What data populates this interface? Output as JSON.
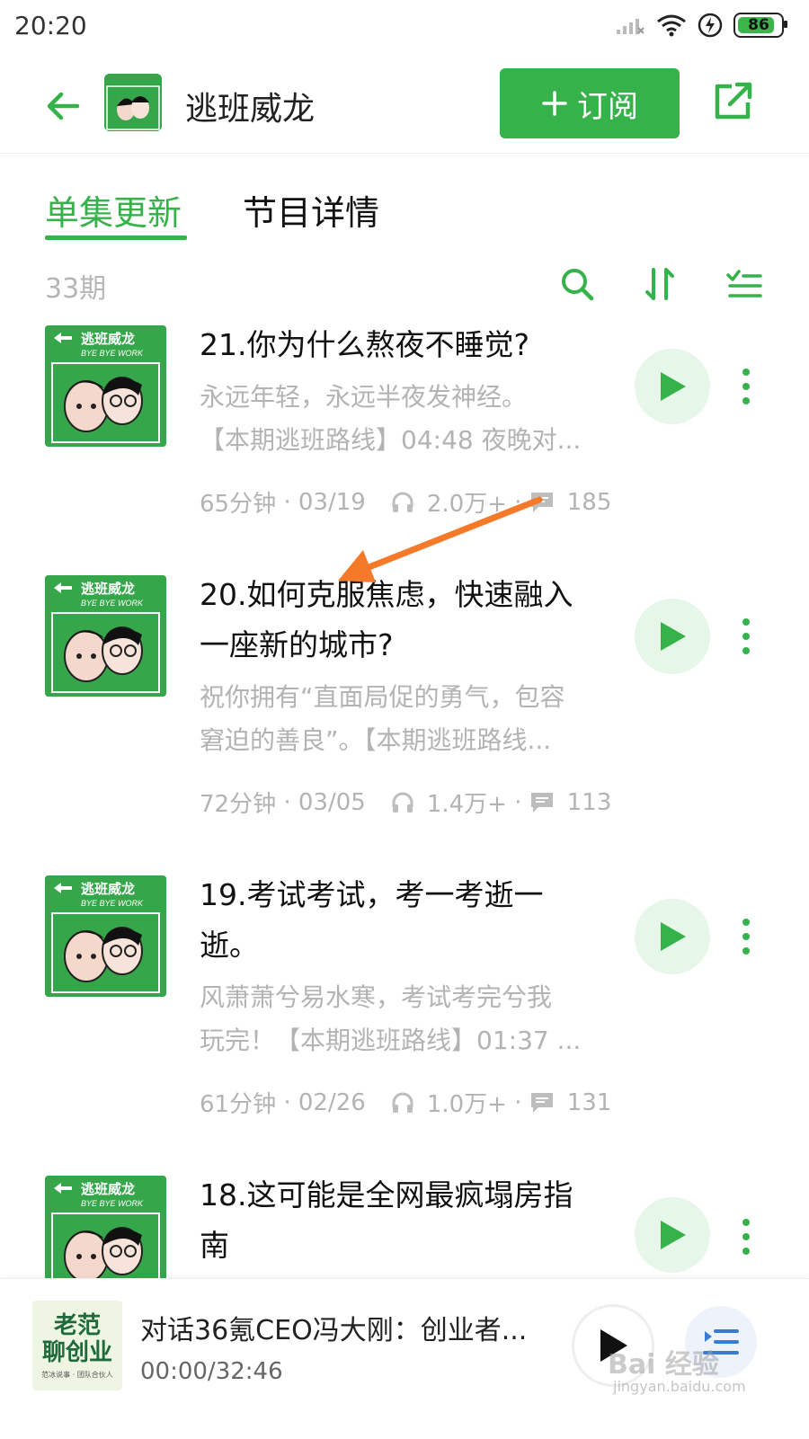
{
  "status_bar": {
    "time": "20:20",
    "battery": "86"
  },
  "header": {
    "title": "逃班威龙",
    "subscribe_label": "订阅"
  },
  "cover_art": {
    "name": "逃班威龙",
    "subtitle": "BYE BYE WORK"
  },
  "tabs": [
    {
      "label": "单集更新",
      "active": true
    },
    {
      "label": "节目详情",
      "active": false
    }
  ],
  "list": {
    "count": "33期"
  },
  "episodes": [
    {
      "title": "21.你为什么熬夜不睡觉?",
      "desc": [
        "永远年轻，永远半夜发神经。",
        "【本期逃班路线】04:48 夜晚对..."
      ],
      "duration": "65分钟",
      "date": "03/19",
      "plays": "2.0万+",
      "comments": "185"
    },
    {
      "title": "20.如何克服焦虑，快速融入一座新的城市?",
      "title_lines": [
        "20.如何克服焦虑，快速融入",
        "一座新的城市?"
      ],
      "desc": [
        "祝你拥有“直面局促的勇气，包容",
        "窘迫的善良”。【本期逃班路线..."
      ],
      "duration": "72分钟",
      "date": "03/05",
      "plays": "1.4万+",
      "comments": "113"
    },
    {
      "title": "19.考试考试，考一考逝一逝。",
      "title_lines": [
        "19.考试考试，考一考逝一",
        "逝。"
      ],
      "desc": [
        "风萧萧兮易水寒，考试考完兮我",
        "玩完！【本期逃班路线】01:37 ..."
      ],
      "duration": "61分钟",
      "date": "02/26",
      "plays": "1.0万+",
      "comments": "131"
    },
    {
      "title": "18.这可能是全网最疯塌房指南",
      "title_lines": [
        "18.这可能是全网最疯塌房指",
        "南"
      ]
    }
  ],
  "player": {
    "cover_line1": "老范",
    "cover_line2": "聊创业",
    "cover_line3": "范冰说事 · 团队合伙人",
    "title": "对话36氪CEO冯大刚：创业者...",
    "time": "00:00/32:46"
  },
  "watermark": {
    "text": "Bai 经验",
    "sub": "jingyan.baidu.com"
  },
  "colors": {
    "accent": "#36b24a",
    "annotation_arrow": "#f47a2a"
  },
  "icons": [
    "back-arrow-icon",
    "share-icon",
    "search-icon",
    "sort-icon",
    "filter-icon",
    "play-icon",
    "more-icon",
    "headphones-icon",
    "comment-icon",
    "playlist-icon"
  ]
}
